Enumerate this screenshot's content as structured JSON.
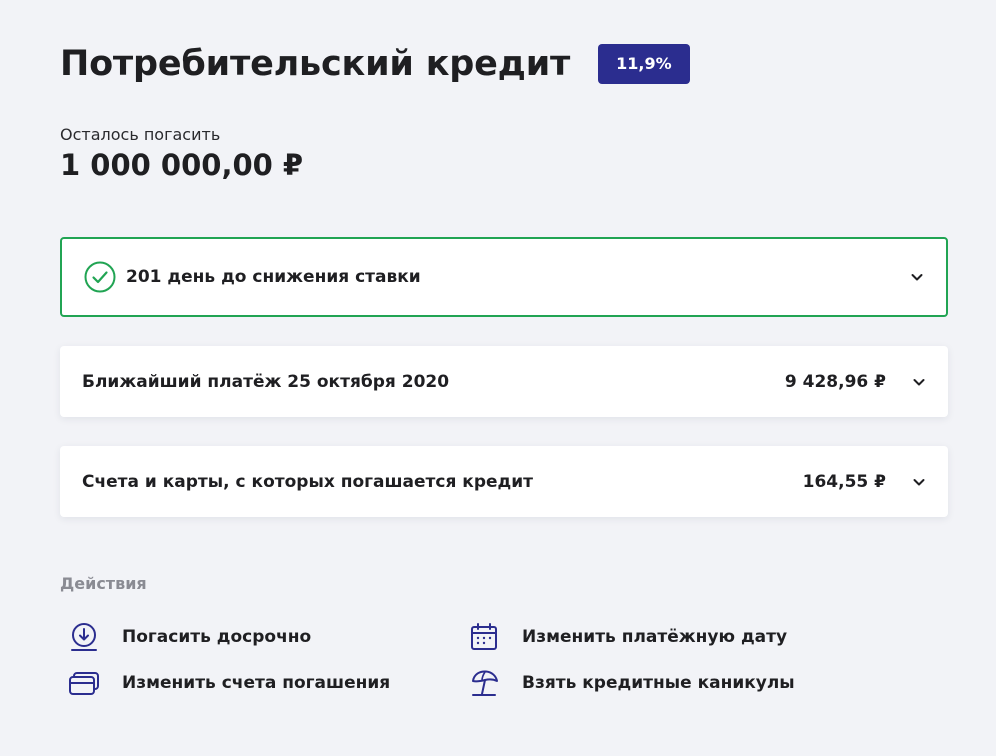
{
  "header": {
    "title": "Потребительский кредит",
    "rate_badge": "11,9%"
  },
  "balance": {
    "label": "Осталось погасить",
    "amount": "1 000 000,00 ₽"
  },
  "cards": {
    "rate_reduction": {
      "text": "201 день до снижения ставки",
      "icon": "check-circle-icon",
      "accent_color": "#21a453"
    },
    "next_payment": {
      "text": "Ближайший платёж 25 октября 2020",
      "value": "9 428,96 ₽"
    },
    "accounts": {
      "text": "Счета и карты, с которых погашается кредит",
      "value": "164,55 ₽"
    }
  },
  "actions": {
    "heading": "Действия",
    "items": [
      {
        "label": "Погасить досрочно",
        "icon": "early-repayment-icon"
      },
      {
        "label": "Изменить платёжную дату",
        "icon": "calendar-icon"
      },
      {
        "label": "Изменить счета погашения",
        "icon": "cards-icon"
      },
      {
        "label": "Взять кредитные каникулы",
        "icon": "beach-umbrella-icon"
      }
    ]
  },
  "colors": {
    "brand": "#2b2d8f",
    "success": "#21a453",
    "background": "#f2f3f7",
    "muted_text": "#8a8b93"
  }
}
